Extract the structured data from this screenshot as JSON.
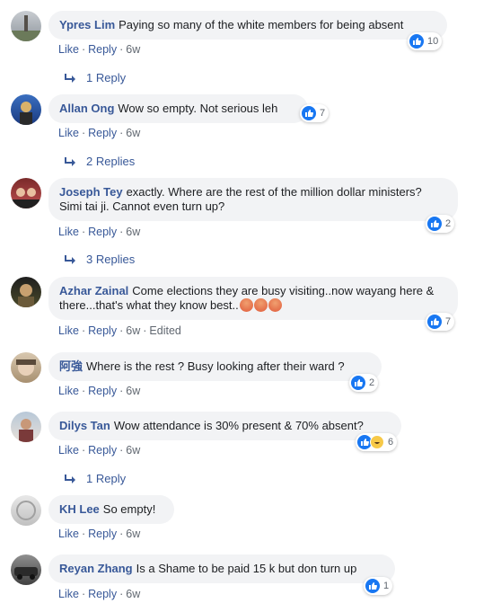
{
  "actions": {
    "like": "Like",
    "reply": "Reply",
    "dot": "·"
  },
  "comments": [
    {
      "author": "Ypres Lim",
      "text": "Paying so many of the white members for being absent",
      "time": "6w",
      "reactions": "10",
      "replies": "1 Reply"
    },
    {
      "author": "Allan Ong",
      "text": "Wow so empty. Not serious leh",
      "time": "6w",
      "reactions": "7",
      "replies": "2 Replies"
    },
    {
      "author": "Joseph Tey",
      "text": "exactly. Where are the rest of the million dollar ministers? Simi tai ji. Cannot even turn up?",
      "time": "6w",
      "reactions": "2",
      "replies": "3 Replies"
    },
    {
      "author": "Azhar Zainal",
      "text": "Come elections they are busy visiting..now wayang here & there...that's what they know best..",
      "time": "6w",
      "edited": "Edited",
      "reactions": "7"
    },
    {
      "author": "阿強",
      "text": "Where is the rest ? Busy looking after their ward ?",
      "time": "6w",
      "reactions": "2"
    },
    {
      "author": "Dilys Tan",
      "text": "Wow attendance is 30% present & 70% absent?",
      "time": "6w",
      "reactions": "6",
      "replies": "1 Reply"
    },
    {
      "author": "KH Lee",
      "text": "So empty!",
      "time": "6w"
    },
    {
      "author": "Reyan Zhang",
      "text": "Is a Shame to be paid 15 k but don turn up",
      "time": "6w",
      "reactions": "1"
    }
  ],
  "colors": {
    "link": "#385898",
    "bubble": "#f2f3f5",
    "like": "#1877f2"
  }
}
